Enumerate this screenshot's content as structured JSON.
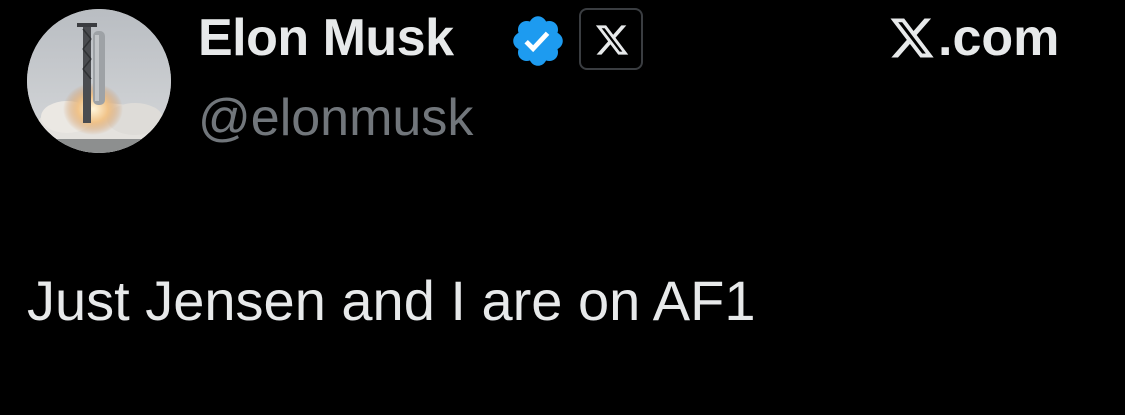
{
  "author": {
    "display_name": "Elon Musk",
    "handle": "@elonmusk",
    "avatar_icon": "rocket-launch-avatar",
    "verified_icon": "verified-badge-icon",
    "verified_color": "#1d9bf0",
    "affiliate_icon": "x-logo-icon"
  },
  "brand": {
    "icon": "x-logo-icon",
    "text": ".com"
  },
  "tweet": {
    "text": "Just Jensen and I are on AF1"
  },
  "colors": {
    "background": "#000000",
    "primary_text": "#e7e9ea",
    "secondary_text": "#71767b"
  }
}
